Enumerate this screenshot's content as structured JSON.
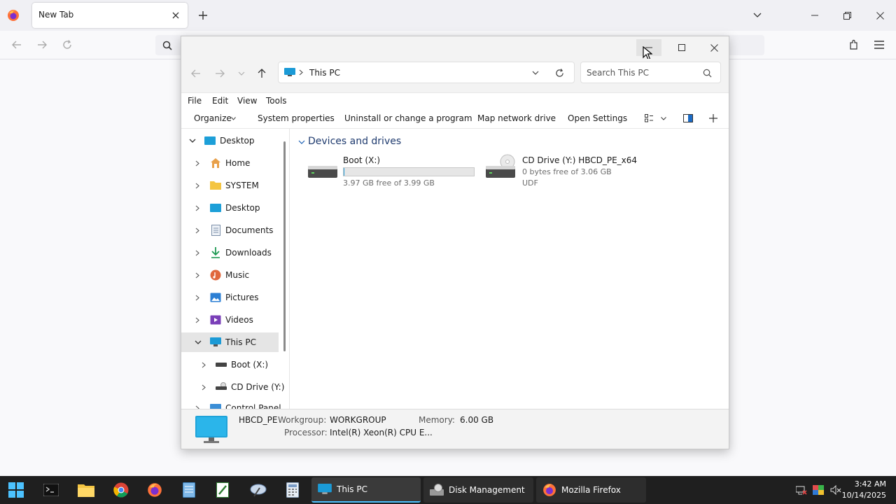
{
  "browser": {
    "tab_title": "New Tab",
    "new_tab_symbol": "+"
  },
  "explorer": {
    "breadcrumb": "This PC",
    "search_placeholder": "Search This PC",
    "menu": [
      "File",
      "Edit",
      "View",
      "Tools"
    ],
    "commands": {
      "organize": "Organize",
      "system_properties": "System properties",
      "uninstall": "Uninstall or change a program",
      "map_drive": "Map network drive",
      "open_settings": "Open Settings"
    },
    "nav": {
      "desktop_root": "Desktop",
      "home": "Home",
      "system": "SYSTEM",
      "desktop": "Desktop",
      "documents": "Documents",
      "downloads": "Downloads",
      "music": "Music",
      "pictures": "Pictures",
      "videos": "Videos",
      "this_pc": "This PC",
      "boot": "Boot (X:)",
      "cd_drive": "CD Drive (Y:)",
      "control_panel": "Control Panel"
    },
    "section_title": "Devices and drives",
    "drives": [
      {
        "name": "Boot (X:)",
        "info": "3.97 GB free of 3.99 GB",
        "used_fraction": 0.005
      },
      {
        "name": "CD Drive (Y:) HBCD_PE_x64",
        "info": "0 bytes free of 3.06 GB",
        "fs": "UDF"
      }
    ],
    "details": {
      "computer_name": "HBCD_PE",
      "workgroup_label": "Workgroup:",
      "workgroup": "WORKGROUP",
      "memory_label": "Memory:",
      "memory": "6.00 GB",
      "processor_label": "Processor:",
      "processor": "Intel(R) Xeon(R) CPU E..."
    }
  },
  "taskbar": {
    "windows": [
      {
        "label": "This PC"
      },
      {
        "label": "Disk Management"
      },
      {
        "label": "Mozilla Firefox"
      }
    ],
    "time": "3:42 AM",
    "date": "10/14/2025"
  },
  "colors": {
    "accent": "#0078d4",
    "taskbar": "#1f1f1f",
    "firefox_orange": "#ff7139"
  }
}
